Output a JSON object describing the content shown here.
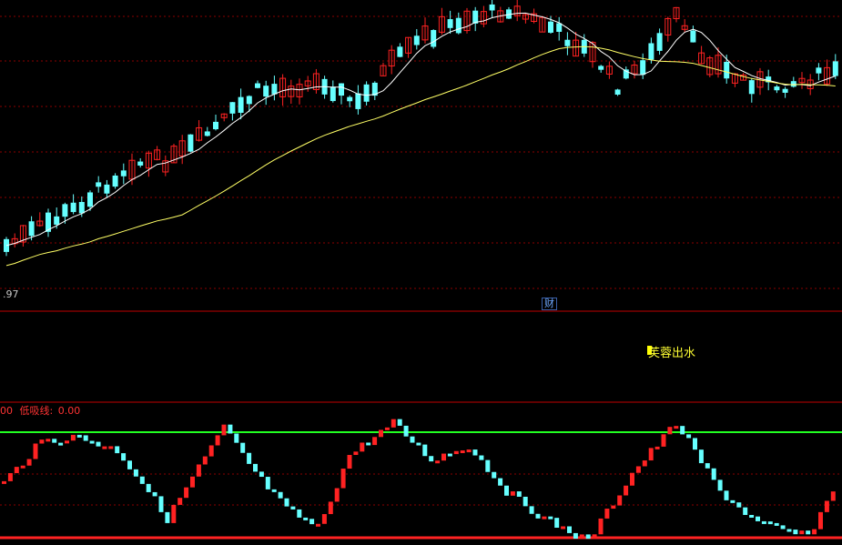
{
  "panels": {
    "main": {
      "price_low_label": ".97",
      "ma_colors": {
        "ma_short": "#ffffff",
        "ma_long": "#ffff66"
      }
    },
    "signal": {
      "finance_badge": "财",
      "signal_label": "芙蓉出水"
    },
    "indicator": {
      "title_prefix": "00",
      "title_name": "低吸线:",
      "title_value": "0.00",
      "upper_line_color": "#22ff22",
      "lower_line_color": "#ff2222"
    }
  },
  "colors": {
    "background": "#000000",
    "up_candle": "#ff2222",
    "down_candle": "#66ffff",
    "grid": "#8b0000",
    "separator": "#c00000"
  }
}
